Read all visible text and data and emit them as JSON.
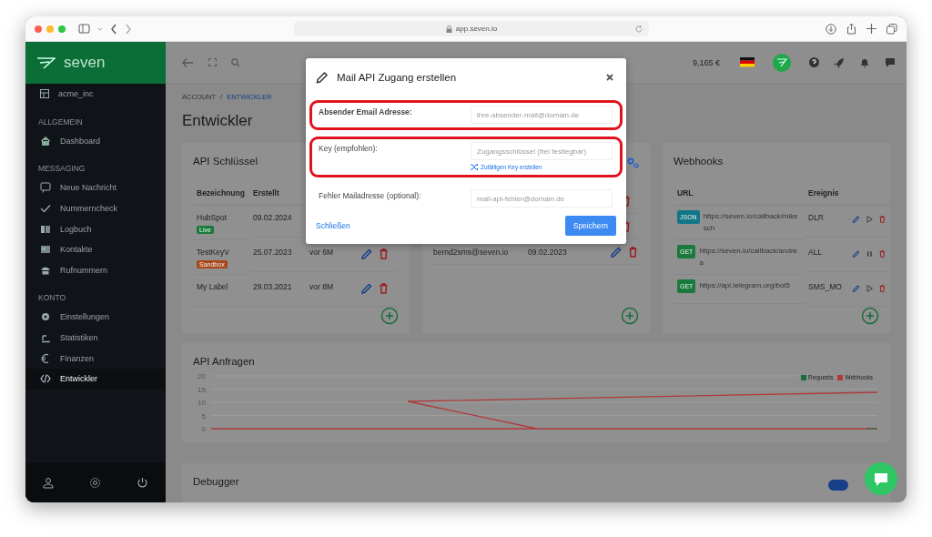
{
  "browser": {
    "address": "app.seven.io"
  },
  "sidebar": {
    "brand": "seven",
    "account": "acme_inc",
    "sections": [
      {
        "heading": "ALLGEMEIN",
        "items": [
          {
            "label": "Dashboard",
            "selected": false
          }
        ]
      },
      {
        "heading": "MESSAGING",
        "items": [
          {
            "label": "Neue Nachricht",
            "selected": false
          },
          {
            "label": "Nummerncheck",
            "selected": false
          },
          {
            "label": "Logbuch",
            "selected": false
          },
          {
            "label": "Kontakte",
            "selected": false
          },
          {
            "label": "Rufnummern",
            "selected": false
          }
        ]
      },
      {
        "heading": "KONTO",
        "items": [
          {
            "label": "Einstellungen",
            "selected": false
          },
          {
            "label": "Statistiken",
            "selected": false
          },
          {
            "label": "Finanzen",
            "selected": false
          },
          {
            "label": "Entwickler",
            "selected": true
          }
        ]
      }
    ]
  },
  "topbar": {
    "balance": "9,165 €"
  },
  "breadcrumb": {
    "items": [
      "ACCOUNT",
      "ENTWICKLER"
    ],
    "separator": "/"
  },
  "page_title": "Entwickler",
  "api_keys": {
    "title": "API Schlüssel",
    "columns": [
      "Bezeichnung",
      "Erstellt"
    ],
    "rows": [
      {
        "name": "HubSpot",
        "tag": {
          "label": "Live",
          "color": "#1a7a3c"
        },
        "created": "09.02.2024"
      },
      {
        "name": "TestKeyV",
        "tag": {
          "label": "Sandbox",
          "color": "#a8481a"
        },
        "created": "25.07.2023",
        "age": "vor 6M",
        "actions": true
      },
      {
        "name": "My Label",
        "created": "29.03.2021",
        "age": "vor 8M",
        "actions": true
      }
    ]
  },
  "mail_accounts": {
    "rows": [
      {
        "edit": false
      },
      {
        "edit": false
      },
      {
        "email": "bernd2sms@seven.io",
        "created": "09.02.2023",
        "edit": true
      }
    ]
  },
  "webhooks": {
    "title": "Webhooks",
    "columns": [
      "URL",
      "Ereignis"
    ],
    "rows": [
      {
        "method": {
          "label": "JSON",
          "color": "#127686"
        },
        "url": "https://seven.io/callback/mikesch",
        "event": "DLR",
        "running": false
      },
      {
        "method": {
          "label": "GET",
          "color": "#1a7a3c"
        },
        "url": "https://seven.io/callback/andrea",
        "event": "ALL",
        "running": true
      },
      {
        "method": {
          "label": "GET",
          "color": "#1a7a3c"
        },
        "url": "https://api.telegram.org/bot5",
        "event": "SMS_MO",
        "running": false
      }
    ]
  },
  "api_requests": {
    "title": "API Anfragen",
    "y_ticks": [
      "20",
      "15",
      "10",
      "5",
      "0"
    ],
    "legend": [
      {
        "label": "Requests",
        "color": "#1f6e3a"
      },
      {
        "label": "Webhooks",
        "color": "#b03a3a"
      }
    ]
  },
  "debugger": {
    "title": "Debugger",
    "enabled": true
  },
  "modal": {
    "title": "Mail API Zugang erstellen",
    "fields": [
      {
        "label": "Absender Email Adresse:",
        "placeholder": "ihre-absender-mail@domain.de",
        "bold": true,
        "highlighted": true
      },
      {
        "label": "Key (empfohlen):",
        "placeholder": "Zugangsschlüssel (frei festlegbar)",
        "bold": false,
        "highlighted": true,
        "link": "Zufälligen Key erstellen"
      },
      {
        "label": "Fehler Mailadresse (optional):",
        "placeholder": "mail-api-fehler@domain.de",
        "bold": false,
        "highlighted": false
      }
    ],
    "close_link": "Schließen",
    "save_button": "Speichern"
  }
}
